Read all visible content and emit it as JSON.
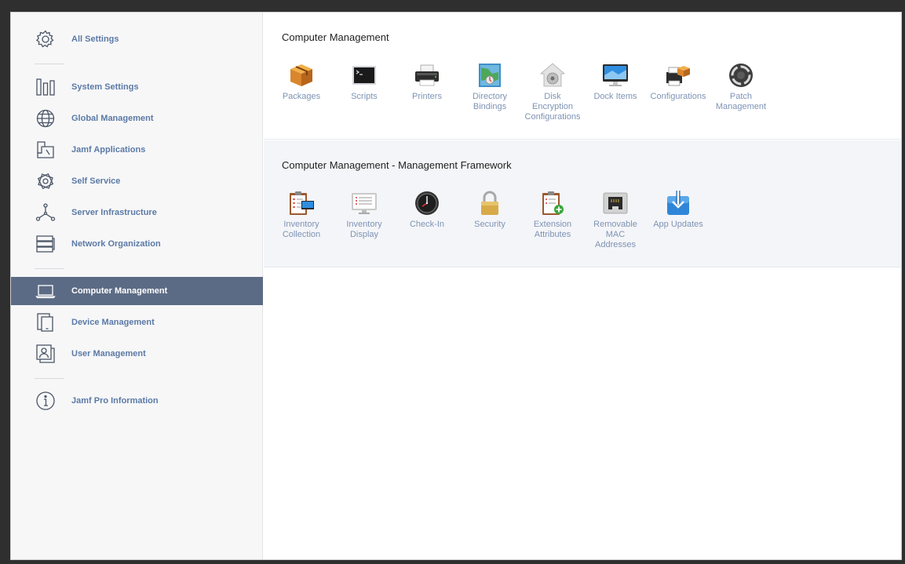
{
  "sidebar": {
    "items": [
      {
        "label": "All Settings",
        "icon": "gear-icon"
      },
      {
        "label": "System Settings",
        "icon": "bars-icon"
      },
      {
        "label": "Global Management",
        "icon": "globe-icon"
      },
      {
        "label": "Jamf Applications",
        "icon": "jamf-apps-icon"
      },
      {
        "label": "Self Service",
        "icon": "self-service-icon"
      },
      {
        "label": "Server Infrastructure",
        "icon": "network-nodes-icon"
      },
      {
        "label": "Network Organization",
        "icon": "server-stack-icon"
      },
      {
        "label": "Computer Management",
        "icon": "laptop-icon",
        "active": true
      },
      {
        "label": "Device Management",
        "icon": "mobile-device-icon"
      },
      {
        "label": "User Management",
        "icon": "user-card-icon"
      },
      {
        "label": "Jamf Pro Information",
        "icon": "info-icon"
      }
    ]
  },
  "sections": [
    {
      "title": "Computer Management",
      "tiles": [
        {
          "label": "Packages",
          "icon": "package-icon"
        },
        {
          "label": "Scripts",
          "icon": "terminal-icon"
        },
        {
          "label": "Printers",
          "icon": "printer-icon"
        },
        {
          "label": "Directory\nBindings",
          "icon": "directory-map-icon"
        },
        {
          "label": "Disk\nEncryption\nConfigurations",
          "icon": "disk-encryption-icon"
        },
        {
          "label": "Dock Items",
          "icon": "monitor-icon"
        },
        {
          "label": "Configurations",
          "icon": "configurations-icon"
        },
        {
          "label": "Patch\nManagement",
          "icon": "patch-icon"
        }
      ]
    },
    {
      "title": "Computer Management - Management Framework",
      "tiles": [
        {
          "label": "Inventory\nCollection",
          "icon": "inventory-collection-icon"
        },
        {
          "label": "Inventory\nDisplay",
          "icon": "inventory-display-icon"
        },
        {
          "label": "Check-In",
          "icon": "clock-icon"
        },
        {
          "label": "Security",
          "icon": "lock-icon"
        },
        {
          "label": "Extension\nAttributes",
          "icon": "extension-attributes-icon"
        },
        {
          "label": "Removable\nMAC\nAddresses",
          "icon": "ethernet-port-icon"
        },
        {
          "label": "App Updates",
          "icon": "app-updates-icon"
        }
      ]
    }
  ],
  "colors": {
    "nav_text": "#5b7aa5",
    "nav_active_bg": "#5c6b85",
    "tile_text": "#7e93b4"
  }
}
